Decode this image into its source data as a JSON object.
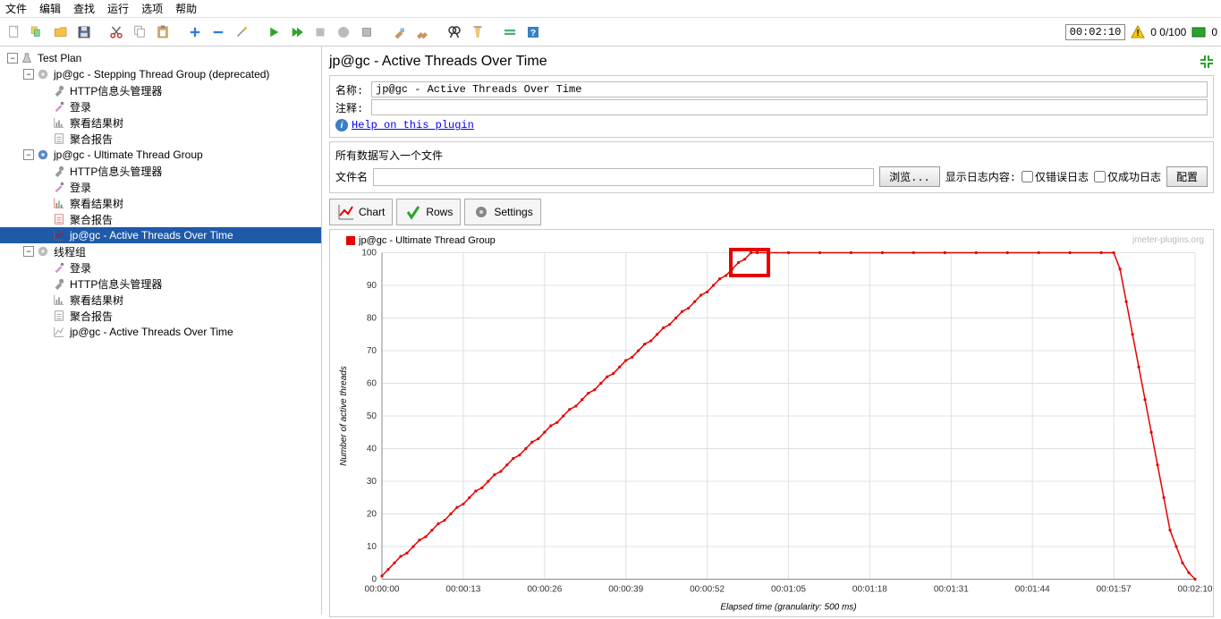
{
  "menu": {
    "items": [
      "文件",
      "编辑",
      "查找",
      "运行",
      "选项",
      "帮助"
    ]
  },
  "status": {
    "timer": "00:02:10",
    "counts": "0  0/100",
    "errors": "0"
  },
  "tree": {
    "root": "Test Plan"
  },
  "tree_items": [
    {
      "indent": 0,
      "expander": "-",
      "icon": "flask",
      "label": "Test Plan"
    },
    {
      "indent": 1,
      "expander": "-",
      "icon": "gear",
      "label": "jp@gc - Stepping Thread Group (deprecated)"
    },
    {
      "indent": 2,
      "expander": "",
      "icon": "wrench",
      "label": "HTTP信息头管理器"
    },
    {
      "indent": 2,
      "expander": "",
      "icon": "pipette",
      "label": "登录"
    },
    {
      "indent": 2,
      "expander": "",
      "icon": "tree-chart",
      "label": "察看结果树"
    },
    {
      "indent": 2,
      "expander": "",
      "icon": "report",
      "label": "聚合报告"
    },
    {
      "indent": 1,
      "expander": "-",
      "icon": "gear-blue",
      "label": "jp@gc - Ultimate Thread Group"
    },
    {
      "indent": 2,
      "expander": "",
      "icon": "wrench",
      "label": "HTTP信息头管理器"
    },
    {
      "indent": 2,
      "expander": "",
      "icon": "pipette",
      "label": "登录"
    },
    {
      "indent": 2,
      "expander": "",
      "icon": "tree-chart-c",
      "label": "察看结果树"
    },
    {
      "indent": 2,
      "expander": "",
      "icon": "report-c",
      "label": "聚合报告"
    },
    {
      "indent": 2,
      "expander": "",
      "icon": "chart-c",
      "label": "jp@gc - Active Threads Over Time",
      "selected": true
    },
    {
      "indent": 1,
      "expander": "-",
      "icon": "gear",
      "label": "线程组"
    },
    {
      "indent": 2,
      "expander": "",
      "icon": "pipette",
      "label": "登录"
    },
    {
      "indent": 2,
      "expander": "",
      "icon": "wrench",
      "label": "HTTP信息头管理器"
    },
    {
      "indent": 2,
      "expander": "",
      "icon": "tree-chart",
      "label": "察看结果树"
    },
    {
      "indent": 2,
      "expander": "",
      "icon": "report",
      "label": "聚合报告"
    },
    {
      "indent": 2,
      "expander": "",
      "icon": "chart",
      "label": "jp@gc - Active Threads Over Time"
    }
  ],
  "panel": {
    "title": "jp@gc - Active Threads Over Time",
    "name_label": "名称:",
    "name_value": "jp@gc - Active Threads Over Time",
    "comment_label": "注释:",
    "comment_value": "",
    "help_link": "Help on this plugin",
    "file_group_title": "所有数据写入一个文件",
    "file_label": "文件名",
    "browse_btn": "浏览...",
    "log_content_label": "显示日志内容:",
    "error_only": "仅错误日志",
    "success_only": "仅成功日志",
    "config_btn": "配置",
    "tab_chart": "Chart",
    "tab_rows": "Rows",
    "tab_settings": "Settings"
  },
  "chart_data": {
    "type": "line",
    "legend": "jp@gc - Ultimate Thread Group",
    "watermark": "jmeter-plugins.org",
    "ylabel": "Number of active threads",
    "xlabel": "Elapsed time (granularity: 500 ms)",
    "ylim": [
      0,
      100
    ],
    "y_ticks": [
      0,
      10,
      20,
      30,
      40,
      50,
      60,
      70,
      80,
      90,
      100
    ],
    "x_ticks": [
      "00:00:00",
      "00:00:13",
      "00:00:26",
      "00:00:39",
      "00:00:52",
      "00:01:05",
      "00:01:18",
      "00:01:31",
      "00:01:44",
      "00:01:57",
      "00:02:10"
    ],
    "series": [
      {
        "name": "jp@gc - Ultimate Thread Group",
        "x_seconds": [
          0,
          1,
          2,
          3,
          4,
          5,
          6,
          7,
          8,
          9,
          10,
          11,
          12,
          13,
          14,
          15,
          16,
          17,
          18,
          19,
          20,
          21,
          22,
          23,
          24,
          25,
          26,
          27,
          28,
          29,
          30,
          31,
          32,
          33,
          34,
          35,
          36,
          37,
          38,
          39,
          40,
          41,
          42,
          43,
          44,
          45,
          46,
          47,
          48,
          49,
          50,
          51,
          52,
          53,
          54,
          55,
          56,
          57,
          58,
          59,
          60,
          65,
          70,
          75,
          80,
          85,
          90,
          95,
          100,
          105,
          110,
          115,
          117,
          118,
          119,
          120,
          121,
          122,
          123,
          124,
          125,
          126,
          127,
          128,
          129,
          130
        ],
        "y": [
          1,
          3,
          5,
          7,
          8,
          10,
          12,
          13,
          15,
          17,
          18,
          20,
          22,
          23,
          25,
          27,
          28,
          30,
          32,
          33,
          35,
          37,
          38,
          40,
          42,
          43,
          45,
          47,
          48,
          50,
          52,
          53,
          55,
          57,
          58,
          60,
          62,
          63,
          65,
          67,
          68,
          70,
          72,
          73,
          75,
          77,
          78,
          80,
          82,
          83,
          85,
          87,
          88,
          90,
          92,
          93,
          95,
          97,
          98,
          100,
          100,
          100,
          100,
          100,
          100,
          100,
          100,
          100,
          100,
          100,
          100,
          100,
          100,
          95,
          85,
          75,
          65,
          55,
          45,
          35,
          25,
          15,
          10,
          5,
          2,
          0
        ]
      }
    ]
  }
}
